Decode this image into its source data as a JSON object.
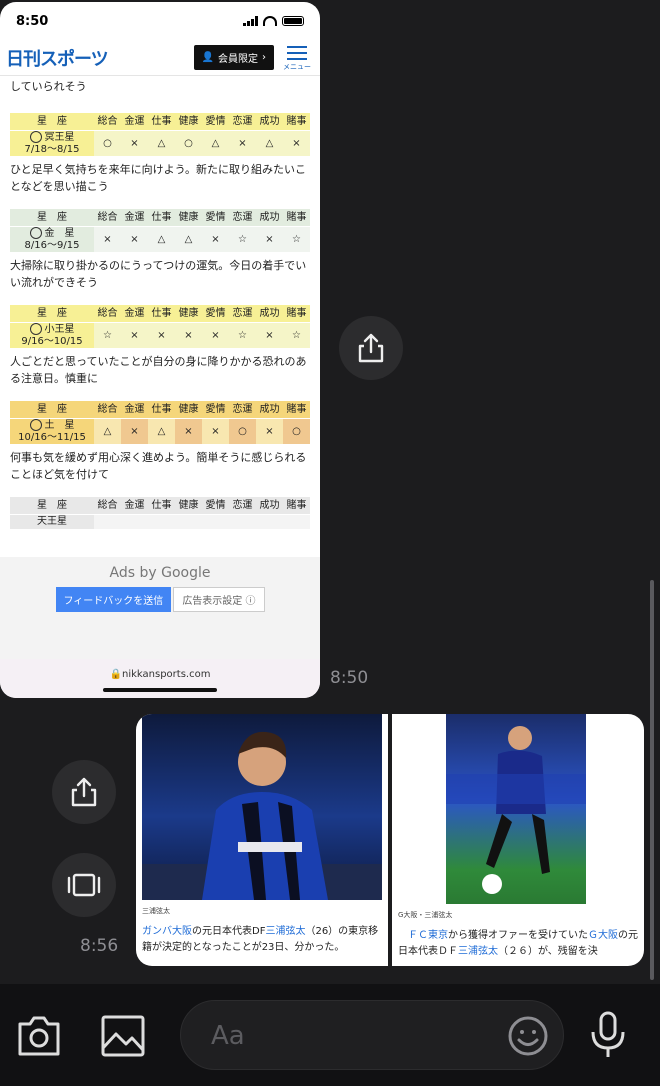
{
  "status": {
    "time": "8:50"
  },
  "site": {
    "logo": "日刊スポーツ",
    "member_label": "会員限定",
    "menu_label": "メニュー"
  },
  "top_text": "していられそう",
  "horoscope_headers": [
    "星　座",
    "総合",
    "金運",
    "仕事",
    "健康",
    "愛情",
    "恋運",
    "成功",
    "賭事"
  ],
  "signs": [
    {
      "name": "冥王星",
      "dates": "7/18〜8/15",
      "ratings": [
        "○",
        "×",
        "△",
        "○",
        "△",
        "×",
        "△",
        "×"
      ],
      "text": "ひと足早く気持ちを来年に向けよう。新たに取り組みたいことなどを思い描こう"
    },
    {
      "name": "金　星",
      "dates": "8/16〜9/15",
      "ratings": [
        "×",
        "×",
        "△",
        "△",
        "×",
        "☆",
        "×",
        "☆"
      ],
      "text": "大掃除に取り掛かるのにうってつけの運気。今日の着手でいい流れができそう"
    },
    {
      "name": "小王星",
      "dates": "9/16〜10/15",
      "ratings": [
        "☆",
        "×",
        "×",
        "×",
        "×",
        "☆",
        "×",
        "☆"
      ],
      "text": "人ごとだと思っていたことが自分の身に降りかかる恐れのある注意日。慎重に"
    },
    {
      "name": "土　星",
      "dates": "10/16〜11/15",
      "ratings": [
        "△",
        "×",
        "△",
        "×",
        "×",
        "○",
        "×",
        "○"
      ],
      "text": "何事も気を緩めず用心深く進めよう。簡単そうに感じられることほど気を付けて"
    },
    {
      "name": "天王星",
      "dates": "",
      "ratings": [
        "",
        "",
        "",
        "",
        "",
        "",
        "",
        ""
      ],
      "text": ""
    }
  ],
  "ads": {
    "ads_by": "Ads by Google",
    "feedback": "フィードバックを送信",
    "ad_settings": "広告表示設定 ⓘ"
  },
  "url": "nikkansports.com",
  "timestamps": {
    "first": "8:50",
    "second": "8:56"
  },
  "news": [
    {
      "caption": "三浦弦太",
      "text_parts": [
        "ガンバ大阪",
        "の元日本代表DF",
        "三浦弦太",
        "（26）の東京移籍が決定的となったことが23日、分かった。"
      ]
    },
    {
      "caption": "G大阪・三浦弦太",
      "text_parts": [
        "ＦＣ東京",
        "から獲得オファーを受けていた",
        "Ｇ大阪",
        "の元日本代表ＤＦ",
        "三浦弦太",
        "（２６）が、残留を決"
      ]
    }
  ],
  "composer": {
    "placeholder": "Aa"
  },
  "icons": [
    "share-icon",
    "camera-icon",
    "image-icon",
    "emoji-icon",
    "microphone-icon",
    "gallery-view-icon"
  ]
}
